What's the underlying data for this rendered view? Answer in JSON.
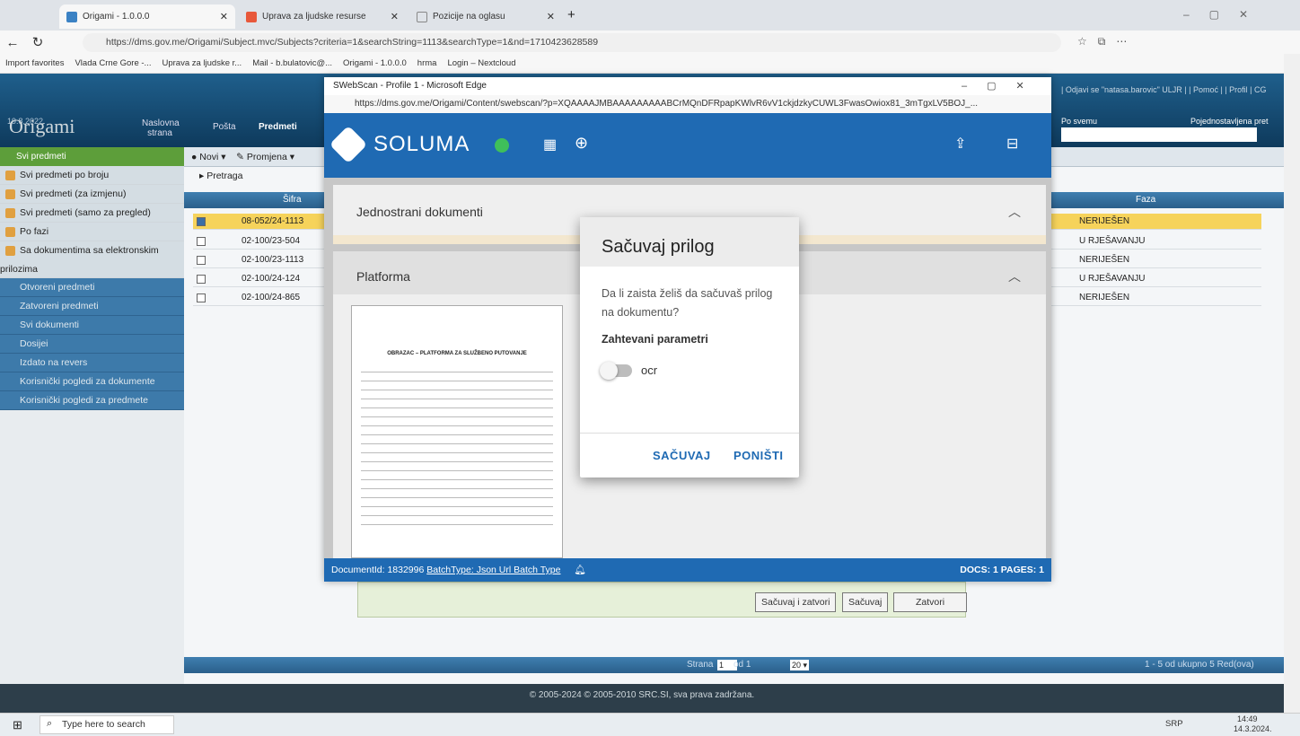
{
  "browser": {
    "tabs": [
      {
        "label": "Origami - 1.0.0.0"
      },
      {
        "label": "Uprava za ljudske resurse"
      },
      {
        "label": "Pozicije na oglasu"
      }
    ],
    "url": "https://dms.gov.me/Origami/Subject.mvc/Subjects?criteria=1&searchString=1113&searchType=1&nd=1710423628589",
    "favorites": [
      "Import favorites",
      "Vlada Crne Gore -...",
      "Uprava za ljudske r...",
      "Mail - b.bulatovic@...",
      "Origami - 1.0.0.0",
      "hrma",
      "Login – Nextcloud"
    ]
  },
  "app": {
    "date": "19.8.2022.",
    "logo": "Origami",
    "nav": [
      "Naslovna strana",
      "Pošta",
      "Predmeti"
    ],
    "topright_links": "| Odjavi se \"natasa.barovic\" ULJR | | Pomoć | | Profil | CG",
    "search_scope": "Po svemu",
    "search_mode": "Pojednostavljena pret",
    "sidebar": {
      "header": "Svi predmeti",
      "items": [
        "Svi predmeti po broju",
        "Svi predmeti (za izmjenu)",
        "Svi predmeti (samo za pregled)",
        "Po fazi",
        "Sa dokumentima sa elektronskim"
      ],
      "wrap": "prilozima",
      "groups": [
        "Otvoreni predmeti",
        "Zatvoreni predmeti",
        "Svi dokumenti",
        "Dosijei",
        "Izdato na revers",
        "Korisnički pogledi za dokumente",
        "Korisnički pogledi za predmete"
      ]
    },
    "toolbar": {
      "new": "Novi",
      "change": "Promjena",
      "search": "Pretraga"
    },
    "grid": {
      "col_code": "Šifra",
      "col_phase": "Faza",
      "rows": [
        {
          "code": "08-052/24-1113",
          "phase": "NERIJEŠEN",
          "selected": true
        },
        {
          "code": "02-100/23-504",
          "phase": "U RJEŠAVANJU",
          "selected": false
        },
        {
          "code": "02-100/23-1113",
          "phase": "NERIJEŠEN",
          "selected": false
        },
        {
          "code": "02-100/24-124",
          "phase": "U RJEŠAVANJU",
          "selected": false
        },
        {
          "code": "02-100/24-865",
          "phase": "NERIJEŠEN",
          "selected": false
        }
      ]
    },
    "pager": {
      "page_label": "Strana",
      "page": "1",
      "of": "od 1",
      "size": "20",
      "summary": "1 - 5 od ukupno 5 Red(ova)"
    },
    "footer": "© 2005-2024 © 2005-2010 SRC.SI, sva prava zadržana.",
    "buttons": {
      "save_close": "Sačuvaj i zatvori",
      "save": "Sačuvaj",
      "close": "Zatvori"
    }
  },
  "popup": {
    "window_title": "SWebScan - Profile 1 - Microsoft Edge",
    "url": "https://dms.gov.me/Origami/Content/swebscan/?p=XQAAAAJMBAAAAAAAAABCrMQnDFRpapKWlvR6vV1ckjdzkyCUWL3FwasOwiox81_3mTgxLV5BOJ_...",
    "brand": "SOLUMA",
    "panel1": "Jednostrani dokumenti",
    "panel2": "Platforma",
    "status_left": "DocumentId: 1832996",
    "status_link": "BatchType: Json Url Batch Type",
    "status_right": "DOCS: 1 PAGES: 1",
    "doc_heading": "OBRAZAC – PLATFORMA ZA SLUŽBENO PUTOVANJE"
  },
  "dialog": {
    "title": "Sačuvaj prilog",
    "message": "Da li zaista želiš da sačuvaš prilog na dokumentu?",
    "params_label": "Zahtevani parametri",
    "ocr_label": "ocr",
    "ocr_enabled": false,
    "save": "SAČUVAJ",
    "cancel": "PONIŠTI"
  },
  "taskbar": {
    "search": "Type here to search",
    "lang": "SRP",
    "time": "14:49",
    "date": "14.3.2024."
  },
  "colors": {
    "accent": "#1f6ab3",
    "selected_row": "#f6d35b",
    "dialog_button": "#1f6ab3"
  }
}
